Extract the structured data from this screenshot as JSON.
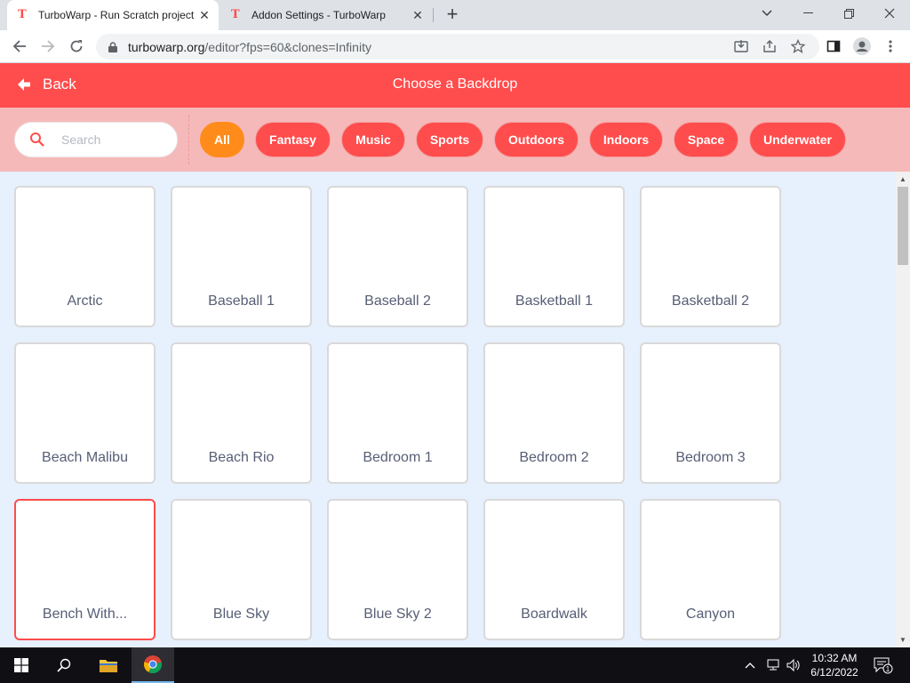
{
  "browser": {
    "tabs": [
      {
        "title": "TurboWarp - Run Scratch project",
        "active": true
      },
      {
        "title": "Addon Settings - TurboWarp",
        "active": false
      }
    ],
    "address": {
      "domain": "turbowarp.org",
      "path": "/editor?fps=60&clones=Infinity"
    }
  },
  "header": {
    "back_label": "Back",
    "title": "Choose a Backdrop"
  },
  "filter": {
    "search_placeholder": "Search",
    "tags": [
      "All",
      "Fantasy",
      "Music",
      "Sports",
      "Outdoors",
      "Indoors",
      "Space",
      "Underwater"
    ],
    "selected_tag": "All"
  },
  "backdrops": [
    {
      "name": "Arctic"
    },
    {
      "name": "Baseball 1"
    },
    {
      "name": "Baseball 2"
    },
    {
      "name": "Basketball 1"
    },
    {
      "name": "Basketball 2"
    },
    {
      "name": "Beach Malibu"
    },
    {
      "name": "Beach Rio"
    },
    {
      "name": "Bedroom 1"
    },
    {
      "name": "Bedroom 2"
    },
    {
      "name": "Bedroom 3"
    },
    {
      "name": "Bench With...",
      "selected": true
    },
    {
      "name": "Blue Sky"
    },
    {
      "name": "Blue Sky 2"
    },
    {
      "name": "Boardwalk"
    },
    {
      "name": "Canyon"
    }
  ],
  "taskbar": {
    "time": "10:32 AM",
    "date": "6/12/2022",
    "notification_count": "1"
  },
  "colors": {
    "accent": "#ff4c4c",
    "selected_tag": "#ff8c1a",
    "filter_bg": "#f6b9b9",
    "grid_bg": "#e7f0fd"
  }
}
